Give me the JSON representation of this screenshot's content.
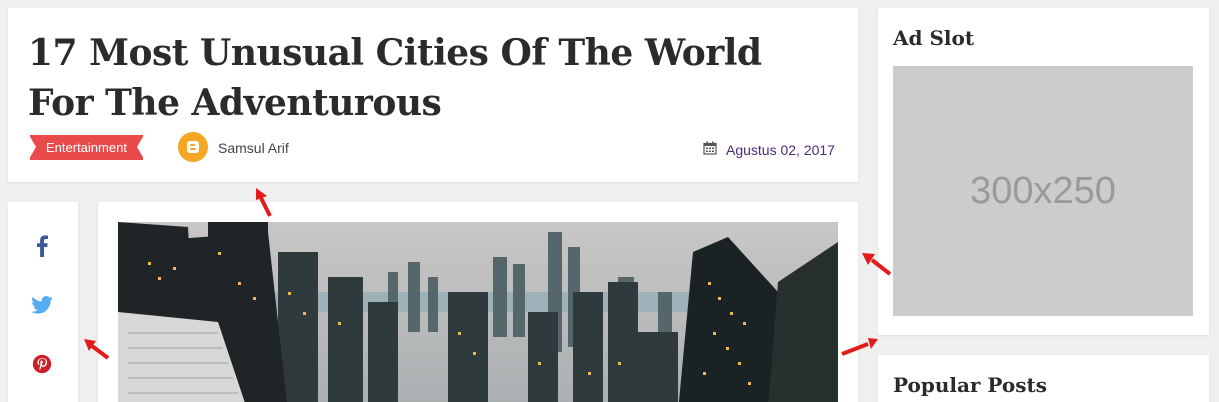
{
  "post": {
    "title": "17 Most Unusual Cities Of The World For The Adventurous",
    "category": "Entertainment",
    "author": "Samsul Arif",
    "date": "Agustus 02, 2017"
  },
  "share": {
    "icons": [
      "facebook-icon",
      "twitter-icon",
      "pinterest-icon"
    ]
  },
  "sidebar": {
    "ad_widget_title": "Ad Slot",
    "ad_placeholder": "300x250",
    "popular_widget_title": "Popular Posts"
  },
  "colors": {
    "category_red": "#e94b4b",
    "date_purple": "#4b2a7a",
    "facebook_blue": "#3b5998",
    "twitter_blue": "#55acee",
    "pinterest_red": "#cb2027",
    "annotation_arrow": "#e31b1b",
    "avatar_orange": "#f5a623"
  }
}
